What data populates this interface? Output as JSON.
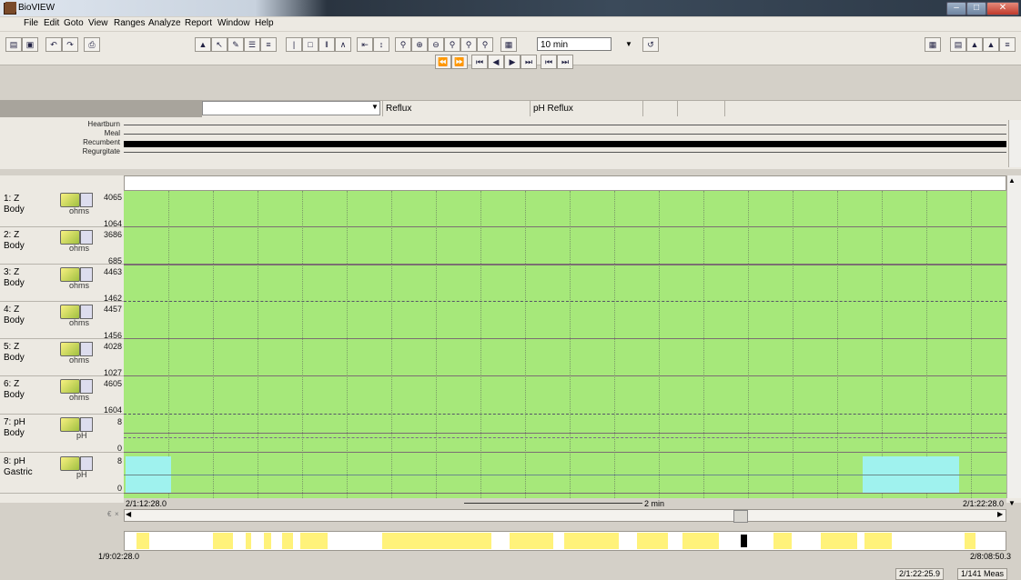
{
  "window": {
    "title": "BioVIEW"
  },
  "menu": [
    "File",
    "Edit",
    "Goto",
    "View",
    "Ranges",
    "Analyze",
    "Report",
    "Window",
    "Help"
  ],
  "toolbar": {
    "zoom_value": "10 min"
  },
  "header": {
    "combo_value": "",
    "col1": "Reflux",
    "col2": "pH Reflux"
  },
  "events": [
    {
      "label": "Heartburn"
    },
    {
      "label": "Meal"
    },
    {
      "label": "Recumbent"
    },
    {
      "label": "Regurgitate"
    }
  ],
  "channels": [
    {
      "line1": "1: Z",
      "line2": "Body",
      "unit": "ohms",
      "max": "4065",
      "min": "1064"
    },
    {
      "line1": "2: Z",
      "line2": "Body",
      "unit": "ohms",
      "max": "3686",
      "min": "685"
    },
    {
      "line1": "3: Z",
      "line2": "Body",
      "unit": "ohms",
      "max": "4463",
      "min": "1462"
    },
    {
      "line1": "4: Z",
      "line2": "Body",
      "unit": "ohms",
      "max": "4457",
      "min": "1456"
    },
    {
      "line1": "5: Z",
      "line2": "Body",
      "unit": "ohms",
      "max": "4028",
      "min": "1027"
    },
    {
      "line1": "6: Z",
      "line2": "Body",
      "unit": "ohms",
      "max": "4605",
      "min": "1604"
    },
    {
      "line1": "7: pH",
      "line2": "Body",
      "unit": "pH",
      "max": "8",
      "min": "0"
    },
    {
      "line1": "8: pH",
      "line2": "Gastric",
      "unit": "pH",
      "max": "8",
      "min": "0"
    }
  ],
  "time_axis": {
    "start": "2/1:12:28.0",
    "span": "2 min",
    "end": "2/1:22:28.0"
  },
  "overview": {
    "start": "1/9:02:28.0",
    "end": "2/8:08:50.3"
  },
  "status": {
    "cursor_time": "2/1:22:25.9",
    "count": "1/141 Meas"
  }
}
